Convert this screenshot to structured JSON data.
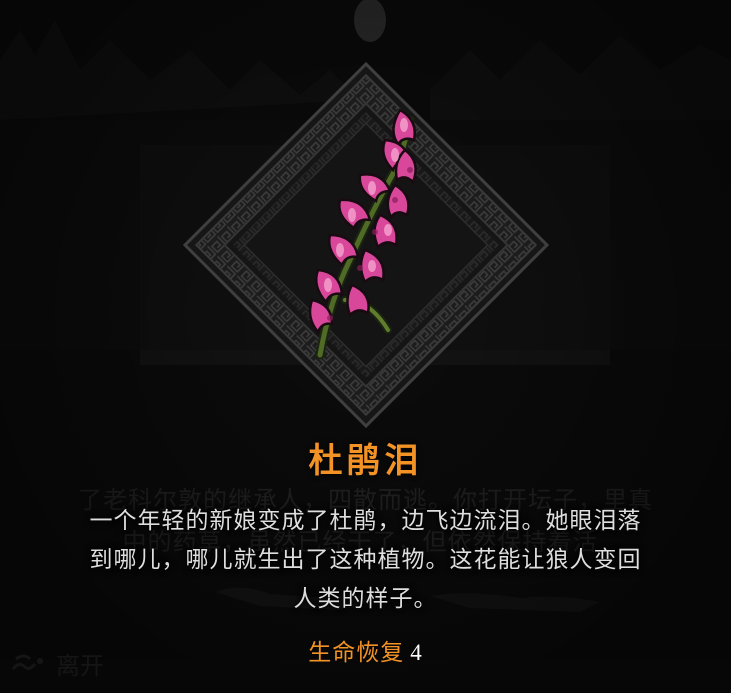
{
  "background": {
    "text_line_1": "了老科尔敦的继承人，四散而逃。你打开坛子，里真",
    "text_line_2": "中的药草，虽然已经干了，但依然保持着活",
    "leave_label": "离开"
  },
  "item": {
    "name": "杜鹃泪",
    "icon": "flower-sprig-icon",
    "description_lines": [
      "一个年轻的新娘变成了杜鹃，边飞边流泪。她眼泪落",
      "到哪儿，哪儿就生出了这种植物。这花能让狼人变回",
      "人类的样子。"
    ],
    "stat": {
      "label": "生命恢复",
      "value": "4"
    }
  },
  "colors": {
    "title": "#f39326",
    "description": "#dedede",
    "background": "#0d0d0d",
    "frame": "#3a3a3a",
    "flower_pink": "#d9479b",
    "stem_green": "#4f6b26"
  }
}
